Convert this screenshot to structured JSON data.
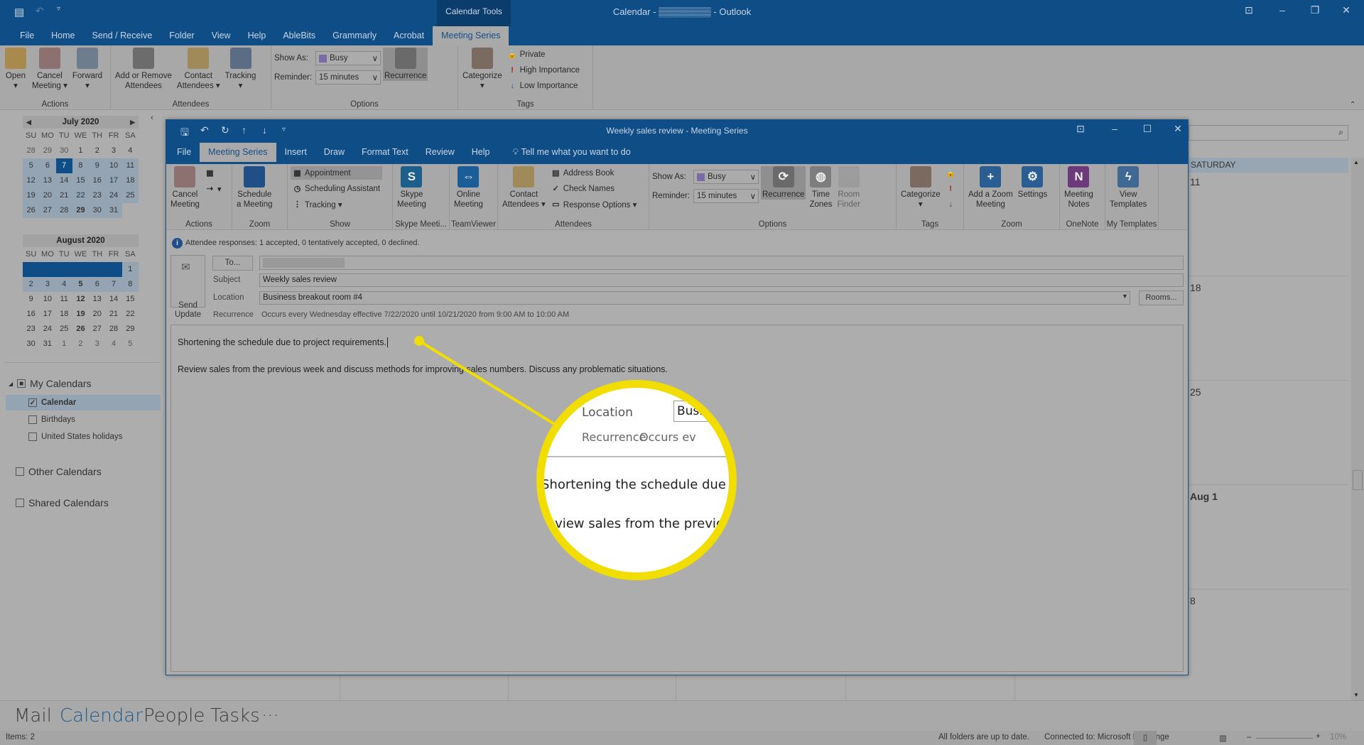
{
  "app": {
    "title": "Calendar - ▒▒▒▒▒▒▒▒ - Outlook",
    "context_tab_group": "Calendar Tools",
    "tabs": [
      "File",
      "Home",
      "Send / Receive",
      "Folder",
      "View",
      "Help",
      "AbleBits",
      "Grammarly",
      "Acrobat",
      "Meeting Series"
    ],
    "active_tab": "Meeting Series"
  },
  "main_ribbon": {
    "groups": [
      {
        "label": "Actions",
        "items": [
          {
            "type": "large",
            "label": "Open\n▾",
            "icon": "folder-icon",
            "color": "#a88a4c"
          },
          {
            "type": "large",
            "label": "Cancel\nMeeting ▾",
            "icon": "cancel-meeting-icon",
            "color": "#8d7070"
          },
          {
            "type": "large",
            "label": "Forward\n▾",
            "icon": "forward-icon",
            "color": "#6d7d8e"
          }
        ]
      },
      {
        "label": "Attendees",
        "items": [
          {
            "type": "large",
            "label": "Add or Remove\nAttendees",
            "icon": "add-remove-attendees-icon",
            "color": "#6c6c6c"
          },
          {
            "type": "large",
            "label": "Contact\nAttendees ▾",
            "icon": "contact-attendees-icon",
            "color": "#a08a5a"
          },
          {
            "type": "large",
            "label": "Tracking\n▾",
            "icon": "tracking-icon",
            "color": "#5a6d85"
          }
        ]
      },
      {
        "label": "Options",
        "items": [
          {
            "type": "fields",
            "fields": [
              {
                "label": "Show As:",
                "value": "Busy",
                "swatch": true
              },
              {
                "label": "Reminder:",
                "value": "15 minutes"
              }
            ]
          },
          {
            "type": "large",
            "label": "Recurrence",
            "icon": "recurrence-icon",
            "color": "#6a6a6a",
            "highlight": true
          }
        ]
      },
      {
        "label": "Tags",
        "items": [
          {
            "type": "large",
            "label": "Categorize\n▾",
            "icon": "categorize-icon",
            "color": "#7a6a60"
          },
          {
            "type": "stack",
            "items": [
              {
                "label": "Private",
                "icon": "lock-icon",
                "glyph": "🔒"
              },
              {
                "label": "High Importance",
                "icon": "high-importance-icon",
                "glyph": "!"
              },
              {
                "label": "Low Importance",
                "icon": "low-importance-icon",
                "glyph": "↓"
              }
            ]
          }
        ]
      }
    ]
  },
  "nav_pane": {
    "months": [
      {
        "title": "July 2020",
        "weekdays": [
          "SU",
          "MO",
          "TU",
          "WE",
          "TH",
          "FR",
          "SA"
        ],
        "weeks": [
          [
            "28",
            "29",
            "30",
            "1",
            "2",
            "3",
            "4"
          ],
          [
            "5",
            "6",
            "7",
            "8",
            "9",
            "10",
            "11"
          ],
          [
            "12",
            "13",
            "14",
            "15",
            "16",
            "17",
            "18"
          ],
          [
            "19",
            "20",
            "21",
            "22",
            "23",
            "24",
            "25"
          ],
          [
            "26",
            "27",
            "28",
            "29",
            "30",
            "31",
            ""
          ]
        ],
        "selected": "7",
        "bold": [
          "29"
        ],
        "highlight_weeks": [
          1,
          2,
          3,
          4
        ]
      },
      {
        "title": "August 2020",
        "weekdays": [
          "SU",
          "MO",
          "TU",
          "WE",
          "TH",
          "FR",
          "SA"
        ],
        "weeks": [
          [
            "",
            "",
            "",
            "",
            "",
            "",
            "1"
          ],
          [
            "2",
            "3",
            "4",
            "5",
            "6",
            "7",
            "8"
          ],
          [
            "9",
            "10",
            "11",
            "12",
            "13",
            "14",
            "15"
          ],
          [
            "16",
            "17",
            "18",
            "19",
            "20",
            "21",
            "22"
          ],
          [
            "23",
            "24",
            "25",
            "26",
            "27",
            "28",
            "29"
          ],
          [
            "30",
            "31",
            "1",
            "2",
            "3",
            "4",
            "5"
          ]
        ],
        "selected": "",
        "bold": [
          "5",
          "12",
          "19",
          "26"
        ],
        "highlight_weeks": [
          0,
          1
        ]
      }
    ],
    "my_calendars": "My Calendars",
    "calendars": [
      {
        "label": "Calendar",
        "checked": true
      },
      {
        "label": "Birthdays",
        "checked": false
      },
      {
        "label": "United States holidays",
        "checked": false
      }
    ],
    "other_calendars": "Other Calendars",
    "shared_calendars": "Shared Calendars"
  },
  "calendar_view": {
    "column_header": "SATURDAY",
    "dates": [
      "11",
      "18",
      "25",
      "Aug 1",
      "8"
    ]
  },
  "meeting_window": {
    "title": "Weekly sales review  -  Meeting Series",
    "tabs": [
      "File",
      "Meeting Series",
      "Insert",
      "Draw",
      "Format Text",
      "Review",
      "Help"
    ],
    "active_tab": "Meeting Series",
    "tell_me": "Tell me what you want to do",
    "ribbon": {
      "groups": [
        {
          "label": "Actions",
          "items": [
            {
              "type": "large",
              "label": "Cancel\nMeeting",
              "icon": "cancel-meeting-icon",
              "color": "#8d7070"
            },
            {
              "type": "stack",
              "items": [
                {
                  "label": "",
                  "icon": "calendar-preview-icon",
                  "glyph": "▦"
                },
                {
                  "label": "▾",
                  "icon": "forward-meeting-icon",
                  "glyph": "⇢"
                }
              ]
            }
          ]
        },
        {
          "label": "Zoom",
          "items": [
            {
              "type": "large",
              "label": "Schedule\na Meeting",
              "icon": "zoom-schedule-icon",
              "color": "#1f4f86"
            }
          ]
        },
        {
          "label": "Show",
          "items": [
            {
              "type": "stack",
              "items": [
                {
                  "label": "Appointment",
                  "icon": "appointment-icon",
                  "glyph": "▦",
                  "highlight": true
                },
                {
                  "label": "Scheduling Assistant",
                  "icon": "scheduling-assistant-icon",
                  "glyph": "◷"
                },
                {
                  "label": "Tracking ▾",
                  "icon": "tracking-icon",
                  "glyph": "⋮"
                }
              ]
            }
          ]
        },
        {
          "label": "Skype Meeti...",
          "items": [
            {
              "type": "large",
              "label": "Skype\nMeeting",
              "icon": "skype-icon",
              "color": "#1c5f8c",
              "glyph": "S"
            }
          ]
        },
        {
          "label": "TeamViewer",
          "items": [
            {
              "type": "large",
              "label": "Online\nMeeting",
              "icon": "teamviewer-icon",
              "color": "#1b5d96",
              "glyph": "⇔"
            }
          ]
        },
        {
          "label": "Attendees",
          "items": [
            {
              "type": "large",
              "label": "Contact\nAttendees ▾",
              "icon": "contact-attendees-icon",
              "color": "#a08a5a"
            },
            {
              "type": "stack",
              "items": [
                {
                  "label": "Address Book",
                  "icon": "address-book-icon",
                  "glyph": "▤"
                },
                {
                  "label": "Check Names",
                  "icon": "check-names-icon",
                  "glyph": "✓"
                },
                {
                  "label": "Response Options ▾",
                  "icon": "response-options-icon",
                  "glyph": "▭"
                }
              ]
            }
          ]
        },
        {
          "label": "Options",
          "items": [
            {
              "type": "fields",
              "fields": [
                {
                  "label": "Show As:",
                  "value": "Busy",
                  "swatch": true
                },
                {
                  "label": "Reminder:",
                  "value": "15 minutes"
                }
              ]
            },
            {
              "type": "large",
              "label": "Recurrence",
              "icon": "recurrence-icon",
              "color": "#6a6a6a",
              "highlight": true,
              "glyph": "⟳"
            },
            {
              "type": "large",
              "label": "Time\nZones",
              "icon": "globe-icon",
              "color": "#7d7d7d",
              "glyph": "◍"
            },
            {
              "type": "large",
              "label": "Room\nFinder",
              "icon": "room-finder-icon",
              "color": "#929292",
              "disabled": true
            }
          ]
        },
        {
          "label": "Tags",
          "items": [
            {
              "type": "large",
              "label": "Categorize\n▾",
              "icon": "categorize-icon",
              "color": "#7a6a60"
            },
            {
              "type": "stack",
              "items": [
                {
                  "label": "",
                  "icon": "lock-icon",
                  "glyph": "🔒"
                },
                {
                  "label": "",
                  "icon": "high-importance-icon",
                  "glyph": "!"
                },
                {
                  "label": "",
                  "icon": "low-importance-icon",
                  "glyph": "↓"
                }
              ]
            }
          ]
        },
        {
          "label": "Zoom",
          "items": [
            {
              "type": "large",
              "label": "Add a Zoom\nMeeting",
              "icon": "zoom-add-icon",
              "color": "#2a5e93",
              "glyph": "+"
            },
            {
              "type": "large",
              "label": "Settings",
              "icon": "settings-icon",
              "color": "#2a5e93",
              "glyph": "⚙"
            }
          ]
        },
        {
          "label": "OneNote",
          "items": [
            {
              "type": "large",
              "label": "Meeting\nNotes",
              "icon": "onenote-icon",
              "color": "#6c3a7a",
              "glyph": "N"
            }
          ]
        },
        {
          "label": "My Templates",
          "items": [
            {
              "type": "large",
              "label": "View\nTemplates",
              "icon": "view-templates-icon",
              "color": "#3f6893",
              "glyph": "ϟ"
            }
          ]
        }
      ]
    },
    "info": "Attendee responses: 1 accepted, 0 tentatively accepted, 0 declined.",
    "send_update": "Send\nUpdate",
    "to_button": "To...",
    "subject_label": "Subject",
    "subject": "Weekly sales review",
    "location_label": "Location",
    "location": "Business breakout room #4",
    "rooms_button": "Rooms...",
    "recurrence_label": "Recurrence",
    "recurrence": "Occurs every Wednesday effective 7/22/2020 until 10/21/2020 from 9:00 AM to 10:00 AM",
    "body": [
      "Shortening the schedule due to project requirements.",
      "Review sales from the previous week and discuss methods for improving sales numbers. Discuss any problematic situations."
    ]
  },
  "magnifier": {
    "location_label": "Location",
    "location_partial": "Busin",
    "recurrence_label": "Recurrence",
    "recurrence_partial": "Occurs ev",
    "line1": "Shortening the schedule due t",
    "line2": "eview sales from the previo",
    "color": "#f2dd00"
  },
  "bottom_nav": {
    "items": [
      "Mail",
      "Calendar",
      "People",
      "Tasks",
      "···"
    ],
    "active": "Calendar"
  },
  "status_bar": {
    "items": "Items: 2",
    "sync": "All folders are up to date.",
    "connection": "Connected to: Microsoft Exchange",
    "zoom": "10%"
  }
}
